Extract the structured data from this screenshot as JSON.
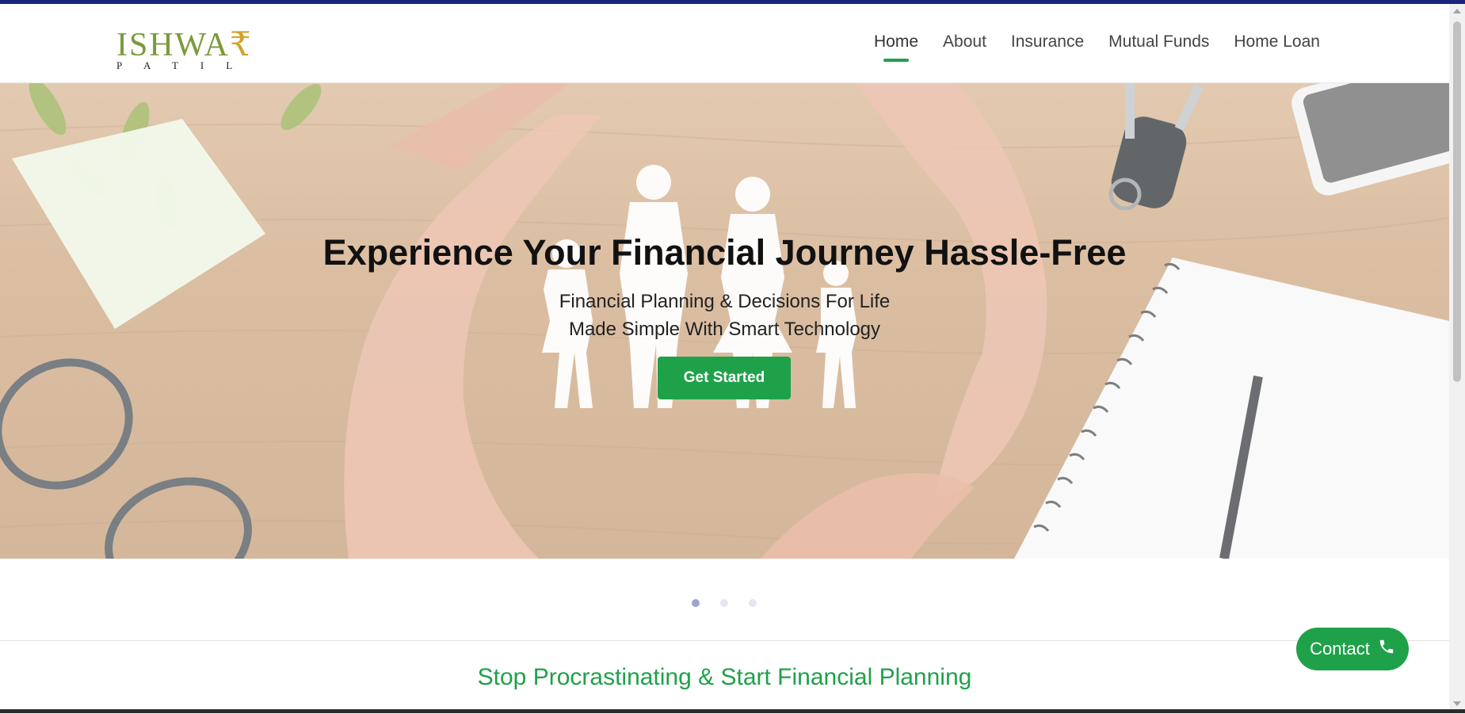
{
  "brand": {
    "logo_main": "ISHWA₹",
    "logo_sub": "PATIL"
  },
  "nav": {
    "items": [
      {
        "label": "Home",
        "active": true
      },
      {
        "label": "About"
      },
      {
        "label": "Insurance"
      },
      {
        "label": "Mutual Funds"
      },
      {
        "label": "Home Loan"
      }
    ]
  },
  "hero": {
    "title": "Experience Your Financial Journey Hassle-Free",
    "subtitle_line1": "Financial Planning & Decisions For Life",
    "subtitle_line2": "Made Simple With Smart Technology",
    "cta_label": "Get Started"
  },
  "carousel": {
    "slide_count": 3,
    "active_index": 0
  },
  "section": {
    "title": "Stop Procrastinating & Start Financial Planning"
  },
  "contact": {
    "label": "Contact",
    "icon": "phone-icon"
  },
  "colors": {
    "accent": "#1fa14a",
    "topbar": "#1a237e",
    "logo_green": "#7a9a3a",
    "rupee_gold": "#d4a02a"
  }
}
